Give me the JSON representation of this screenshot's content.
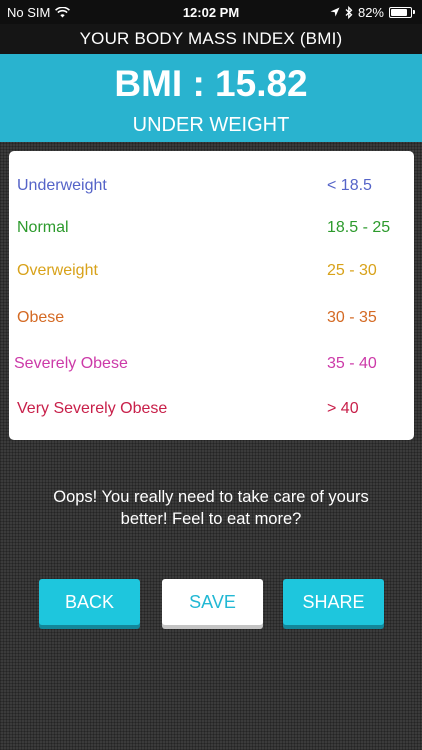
{
  "status_bar": {
    "carrier": "No SIM",
    "time": "12:02 PM",
    "battery_percent": "82%",
    "battery_level": 0.82,
    "icons": [
      "wifi-icon",
      "location-icon",
      "bluetooth-icon",
      "battery-icon"
    ]
  },
  "header": {
    "title": "YOUR BODY MASS INDEX (BMI)"
  },
  "bmi": {
    "value_text": "BMI : 15.82",
    "category": "UNDER WEIGHT"
  },
  "table": {
    "rows": [
      {
        "label": "Underweight",
        "range": "< 18.5",
        "color": "#5564c8"
      },
      {
        "label": "Normal",
        "range": "18.5 - 25",
        "color": "#2c9a2c"
      },
      {
        "label": "Overweight",
        "range": "25 - 30",
        "color": "#d8a21a"
      },
      {
        "label": "Obese",
        "range": "30 - 35",
        "color": "#d46a24"
      },
      {
        "label": "Severely Obese",
        "range": "35 - 40",
        "color": "#cc3aa8"
      },
      {
        "label": "Very Severely Obese",
        "range": "> 40",
        "color": "#c8204a"
      }
    ]
  },
  "message": {
    "line1": "Oops! You really need to take care of yours",
    "line2": "better! Feel to eat more?"
  },
  "buttons": {
    "back": "BACK",
    "save": "SAVE",
    "share": "SHARE"
  },
  "colors": {
    "accent": "#29b3cf",
    "button_cyan": "#1ec6dd",
    "header_bg": "#151515"
  }
}
